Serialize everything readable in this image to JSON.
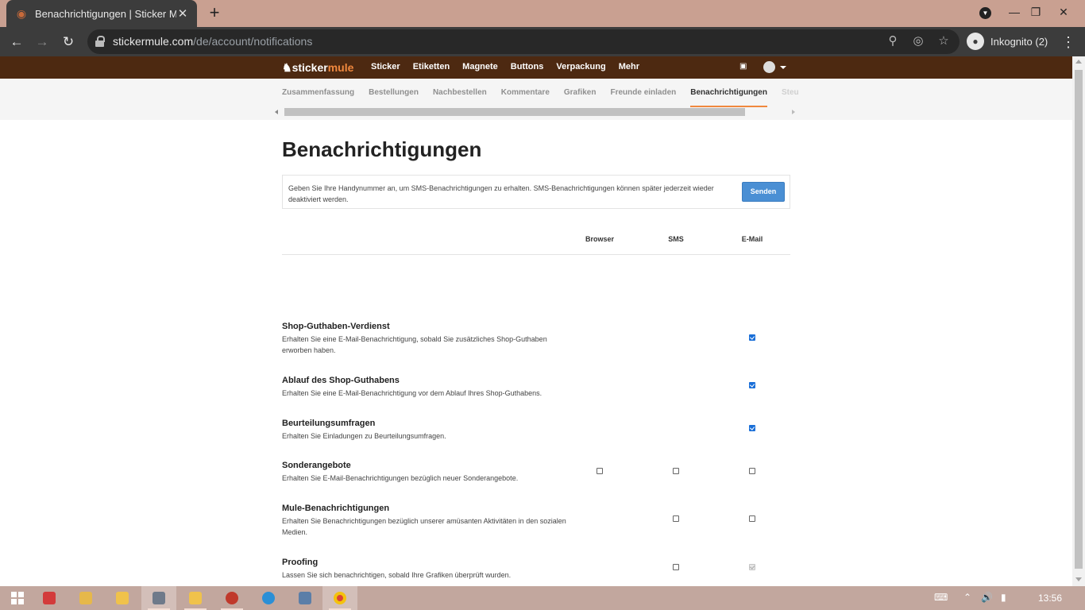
{
  "browser": {
    "tab_title": "Benachrichtigungen | Sticker Mule",
    "url_domain": "stickermule.com",
    "url_path": "/de/account/notifications",
    "incognito_label": "Inkognito (2)"
  },
  "site": {
    "logo_sticker": "sticker",
    "logo_mule": "mule",
    "nav": [
      "Sticker",
      "Etiketten",
      "Magnete",
      "Buttons",
      "Verpackung",
      "Mehr"
    ],
    "subnav": [
      "Zusammenfassung",
      "Bestellungen",
      "Nachbestellen",
      "Kommentare",
      "Grafiken",
      "Freunde einladen",
      "Benachrichtigungen",
      "Steuern"
    ],
    "subnav_active": "Benachrichtigungen"
  },
  "page": {
    "title": "Benachrichtigungen",
    "sms_prompt": "Geben Sie Ihre Handynummer an, um SMS-Benachrichtigungen zu erhalten. SMS-Benachrichtigungen können später jederzeit wieder deaktiviert werden.",
    "send_button": "Senden",
    "columns": [
      "Browser",
      "SMS",
      "E-Mail"
    ],
    "rows": [
      {
        "title": "Shop-Guthaben-Verdienst",
        "desc": "Erhalten Sie eine E-Mail-Benachrichtigung, sobald Sie zusätzliches Shop-Guthaben erworben haben.",
        "browser": null,
        "sms": null,
        "email": "checked"
      },
      {
        "title": "Ablauf des Shop-Guthabens",
        "desc": "Erhalten Sie eine E-Mail-Benachrichtigung vor dem Ablauf Ihres Shop-Guthabens.",
        "browser": null,
        "sms": null,
        "email": "checked"
      },
      {
        "title": "Beurteilungsumfragen",
        "desc": "Erhalten Sie Einladungen zu Beurteilungsumfragen.",
        "browser": null,
        "sms": null,
        "email": "checked"
      },
      {
        "title": "Sonderangebote",
        "desc": "Erhalten Sie E-Mail-Benachrichtigungen bezüglich neuer Sonderangebote.",
        "browser": "unchecked",
        "sms": "unchecked",
        "email": "unchecked"
      },
      {
        "title": "Mule-Benachrichtigungen",
        "desc": "Erhalten Sie Benachrichtigungen bezüglich unserer amüsanten Aktivitäten in den sozialen Medien.",
        "browser": null,
        "sms": "unchecked",
        "email": "unchecked"
      },
      {
        "title": "Proofing",
        "desc": "Lassen Sie sich benachrichtigen, sobald Ihre Grafiken überprüft wurden.",
        "browser": null,
        "sms": "unchecked",
        "email": "checked-disabled"
      }
    ]
  },
  "taskbar": {
    "clock": "13:56"
  },
  "colors": {
    "site_nav": "#4d2911",
    "accent_orange": "#f0883e",
    "send_button": "#4a8fd4",
    "checkbox_checked": "#1a6fd8"
  }
}
